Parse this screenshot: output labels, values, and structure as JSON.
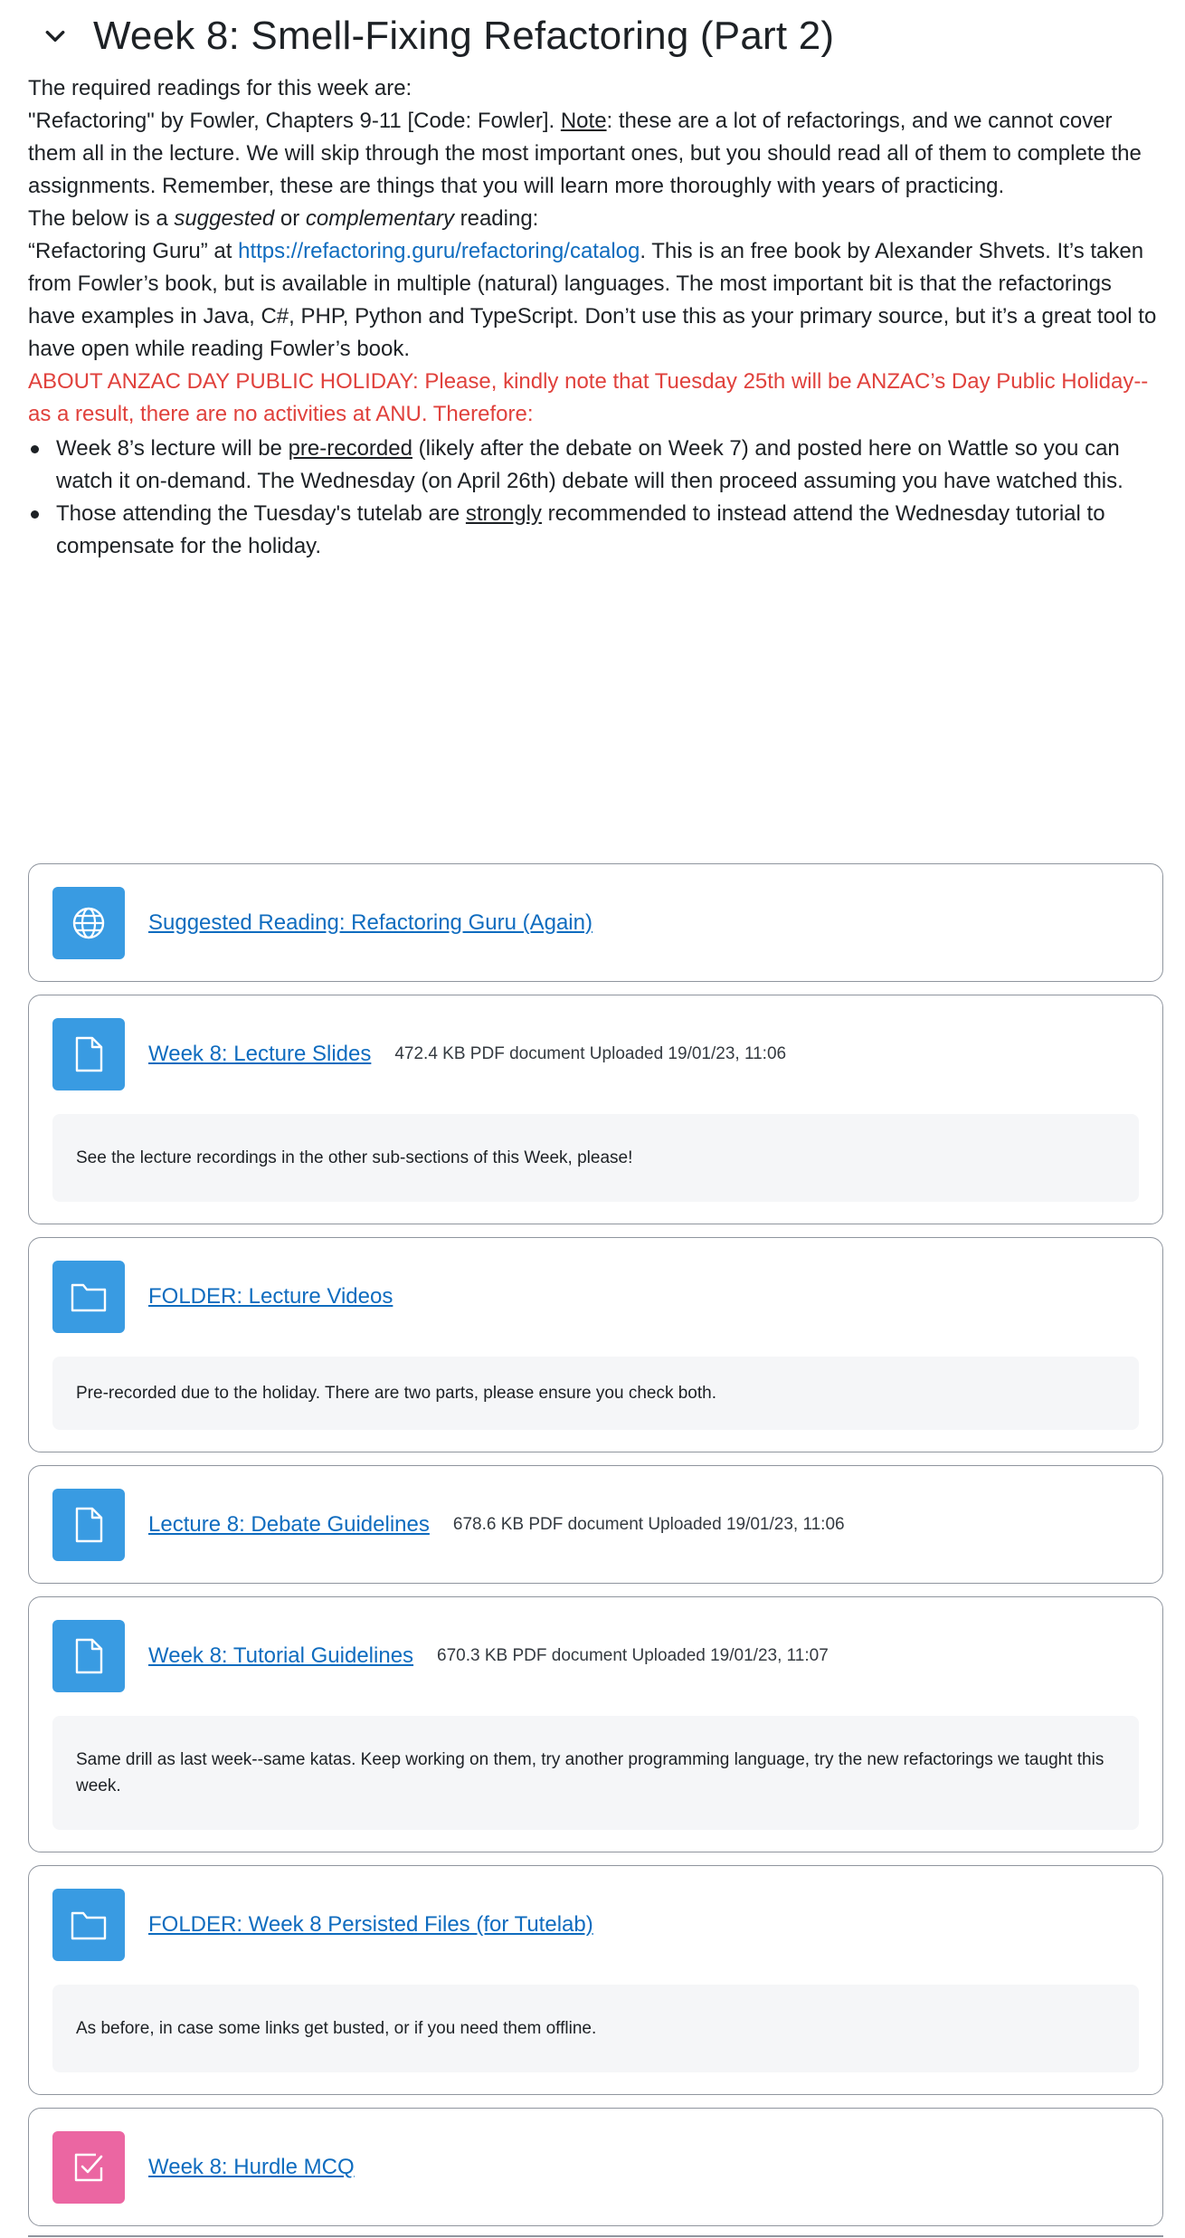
{
  "section": {
    "title": "Week 8: Smell-Fixing Refactoring (Part 2)",
    "collapse_icon": "chevron-down-icon"
  },
  "summary": {
    "intro": "The required readings for this week are:",
    "fowler_a": "\"Refactoring\" by Fowler, Chapters 9-11  [Code: Fowler]. ",
    "fowler_note": "Note",
    "fowler_b": ": these are a lot of refactorings, and we cannot cover them all in the lecture. We will skip through the most important ones, but you should read all of them to complete the assignments. Remember, these are things that you will learn more thoroughly with years of practicing.",
    "below_a": "The below is a ",
    "below_suggested": "suggested",
    "below_or": " or ",
    "below_complementary": "complementary",
    "below_b": " reading:",
    "guru_a": " “Refactoring Guru” at ",
    "guru_link": "https://refactoring.guru/refactoring/catalog",
    "guru_b": ". This is an free book by Alexander Shvets. It’s taken from Fowler’s book, but is available in multiple (natural) languages. The most important bit is that the refactorings have examples in Java, C#, PHP, Python and TypeScript. Don’t use this as your primary source, but it’s a great tool to have open while reading Fowler’s book.",
    "anzac": "ABOUT ANZAC DAY PUBLIC HOLIDAY: Please, kindly note that Tuesday 25th will be ANZAC’s Day Public Holiday--as a result, there are no activities at ANU. Therefore:",
    "bullet1_a": "Week 8’s lecture will be ",
    "bullet1_u": "pre-recorded",
    "bullet1_b": " (likely after the debate on Week 7) and posted here on Wattle so you can watch it on-demand. The Wednesday (on April 26th) debate will then proceed assuming you have watched this.",
    "bullet2_a": "Those attending the Tuesday's tutelab are ",
    "bullet2_u": "strongly",
    "bullet2_b": " recommended to instead attend the Wednesday tutorial to compensate for the holiday."
  },
  "activities": [
    {
      "name": "Suggested Reading: Refactoring Guru (Again)",
      "details": "",
      "desc": "",
      "icon": "globe-icon"
    },
    {
      "name": "Week 8: Lecture Slides",
      "details": "472.4 KB PDF document Uploaded 19/01/23, 11:06",
      "desc": "See the lecture recordings in the other sub-sections of this Week, please!",
      "icon": "file-icon"
    },
    {
      "name": "FOLDER: Lecture Videos",
      "details": "",
      "desc": "Pre-recorded due to the holiday. There are two parts, please ensure you check both.",
      "icon": "folder-icon"
    },
    {
      "name": "Lecture 8: Debate Guidelines",
      "details": "678.6 KB PDF document Uploaded 19/01/23, 11:06",
      "desc": "",
      "icon": "file-icon"
    },
    {
      "name": "Week 8: Tutorial Guidelines",
      "details": "670.3 KB PDF document Uploaded 19/01/23, 11:07",
      "desc": "Same drill as last week--same katas. Keep working on them, try another programming language, try the new refactorings we taught this week.",
      "icon": "file-icon"
    },
    {
      "name": "FOLDER: Week 8 Persisted Files (for Tutelab)",
      "details": "",
      "desc": "As before, in case some links get busted, or if you need them offline.",
      "icon": "folder-icon"
    },
    {
      "name": "Week 8: Hurdle MCQ",
      "details": "",
      "desc": "",
      "icon": "quiz-icon"
    }
  ],
  "colors": {
    "link": "#0f6cbf",
    "alert": "#e0413c",
    "resource_icon_bg": "#399be2",
    "quiz_icon_bg": "#eb66a2"
  }
}
